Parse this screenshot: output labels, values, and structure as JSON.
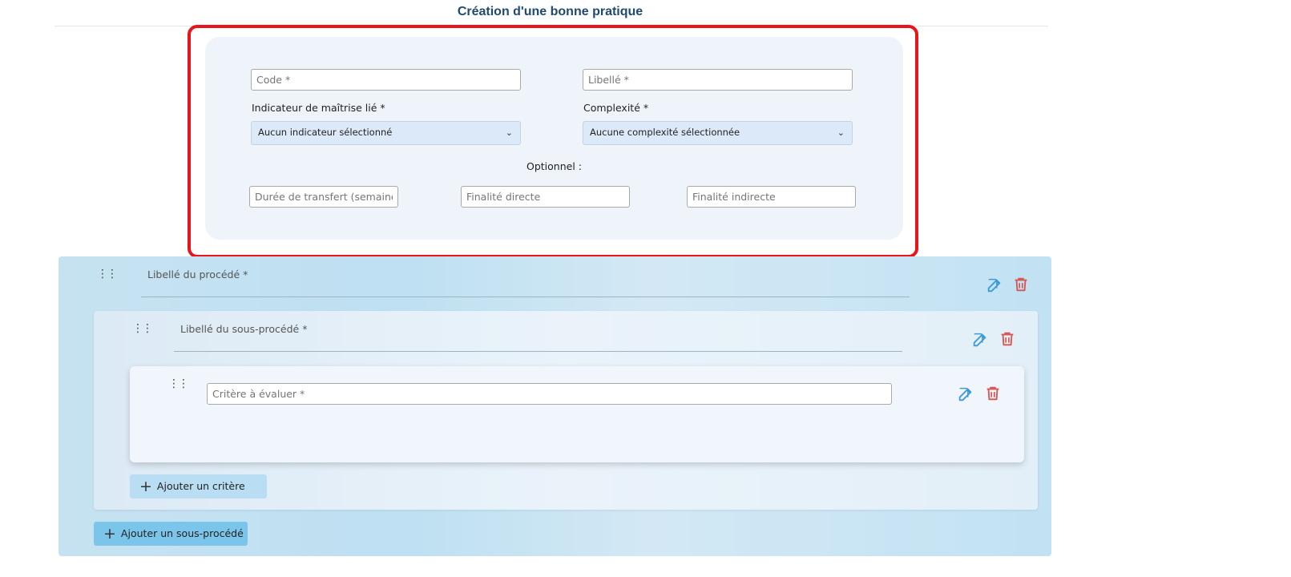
{
  "header": {
    "title": "Création d'une bonne pratique"
  },
  "form": {
    "code": {
      "value": "",
      "placeholder": "Code *"
    },
    "libelle": {
      "value": "",
      "placeholder": "Libellé *"
    },
    "indicateur": {
      "label": "Indicateur de maîtrise lié *",
      "selected": "Aucun indicateur sélectionné"
    },
    "complexite": {
      "label": "Complexité *",
      "selected": "Aucune complexité sélectionnée"
    },
    "optional_label": "Optionnel :",
    "duree": {
      "value": "",
      "placeholder": "Durée de transfert (semaines)"
    },
    "finalite_directe": {
      "value": "",
      "placeholder": "Finalité directe"
    },
    "finalite_indirecte": {
      "value": "",
      "placeholder": "Finalité indirecte"
    }
  },
  "procede": {
    "label": "Libellé du procédé *",
    "sous_procede": {
      "label": "Libellé du sous-procédé *",
      "critere": {
        "value": "",
        "placeholder": "Critère à évaluer *"
      },
      "add_critere_label": "Ajouter un critère"
    },
    "add_sous_procede_label": "Ajouter un sous-procédé"
  },
  "colors": {
    "edit_icon": "#3d9bd6",
    "delete_icon": "#d9534f",
    "highlight": "#e8141c",
    "title": "#1f4a6e"
  }
}
